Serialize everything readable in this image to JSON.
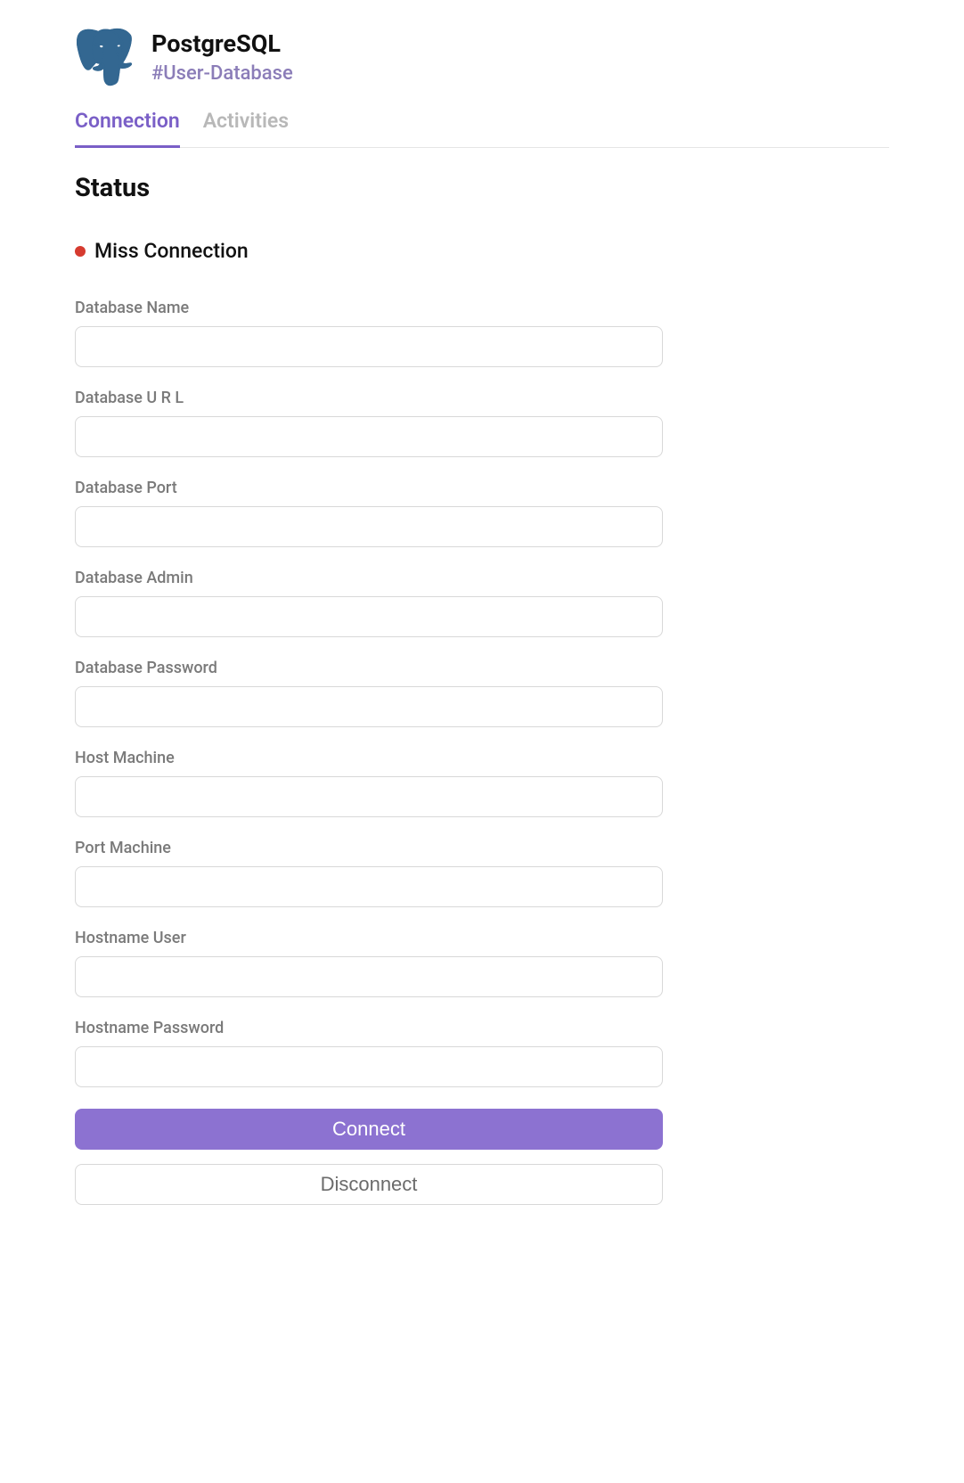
{
  "header": {
    "title": "PostgreSQL",
    "subtitle": "#User-Database"
  },
  "tabs": [
    {
      "label": "Connection",
      "active": true
    },
    {
      "label": "Activities",
      "active": false
    }
  ],
  "section_title": "Status",
  "status": {
    "text": "Miss Connection",
    "color": "#d63b2f"
  },
  "form": {
    "fields": [
      {
        "label": "Database Name",
        "value": "",
        "type": "text"
      },
      {
        "label": "Database U R L",
        "value": "",
        "type": "text"
      },
      {
        "label": "Database Port",
        "value": "",
        "type": "text"
      },
      {
        "label": "Database Admin",
        "value": "",
        "type": "text"
      },
      {
        "label": "Database Password",
        "value": "",
        "type": "password"
      },
      {
        "label": "Host Machine",
        "value": "",
        "type": "text"
      },
      {
        "label": "Port Machine",
        "value": "",
        "type": "text"
      },
      {
        "label": "Hostname User",
        "value": "",
        "type": "text"
      },
      {
        "label": "Hostname Password",
        "value": "",
        "type": "password"
      }
    ]
  },
  "buttons": {
    "connect_label": "Connect",
    "disconnect_label": "Disconnect"
  }
}
